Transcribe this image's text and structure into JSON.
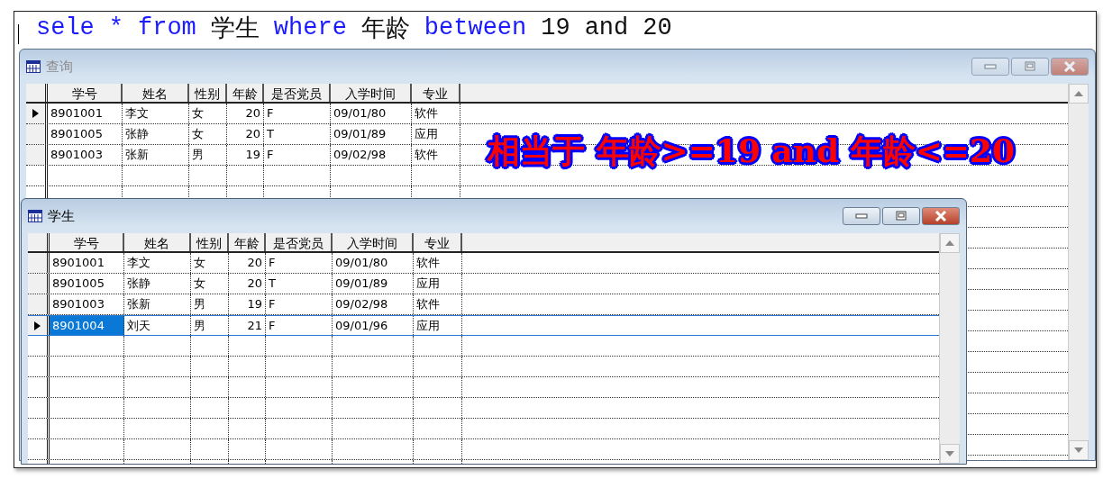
{
  "command": [
    {
      "text": "sele",
      "kind": "keyword"
    },
    {
      "text": "*",
      "kind": "keyword"
    },
    {
      "text": "from",
      "kind": "keyword"
    },
    {
      "text": "学生",
      "kind": "plain"
    },
    {
      "text": "where",
      "kind": "keyword"
    },
    {
      "text": "年龄",
      "kind": "plain"
    },
    {
      "text": "between",
      "kind": "keyword"
    },
    {
      "text": "19",
      "kind": "plain"
    },
    {
      "text": "and",
      "kind": "plain"
    },
    {
      "text": "20",
      "kind": "plain"
    }
  ],
  "windows": [
    {
      "title": "查询",
      "active": false,
      "columns": [
        "学号",
        "姓名",
        "性别",
        "年龄",
        "是否党员",
        "入学时间",
        "专业"
      ],
      "rows": [
        {
          "cells": [
            "8901001",
            "李文",
            "女",
            "20",
            "F",
            "09/01/80",
            "软件"
          ],
          "current": true,
          "selected": false
        },
        {
          "cells": [
            "8901005",
            "张静",
            "女",
            "20",
            "T",
            "09/01/89",
            "应用"
          ],
          "current": false,
          "selected": false
        },
        {
          "cells": [
            "8901003",
            "张新",
            "男",
            "19",
            "F",
            "09/02/98",
            "软件"
          ],
          "current": false,
          "selected": false
        }
      ]
    },
    {
      "title": "学生",
      "active": true,
      "columns": [
        "学号",
        "姓名",
        "性别",
        "年龄",
        "是否党员",
        "入学时间",
        "专业"
      ],
      "rows": [
        {
          "cells": [
            "8901001",
            "李文",
            "女",
            "20",
            "F",
            "09/01/80",
            "软件"
          ],
          "current": false,
          "selected": false
        },
        {
          "cells": [
            "8901005",
            "张静",
            "女",
            "20",
            "T",
            "09/01/89",
            "应用"
          ],
          "current": false,
          "selected": false
        },
        {
          "cells": [
            "8901003",
            "张新",
            "男",
            "19",
            "F",
            "09/02/98",
            "软件"
          ],
          "current": false,
          "selected": false
        },
        {
          "cells": [
            "8901004",
            "刘天",
            "男",
            "21",
            "F",
            "09/01/96",
            "应用"
          ],
          "current": true,
          "selected": true
        }
      ]
    }
  ],
  "annotation": "相当于 年龄>=19 and 年龄<=20"
}
